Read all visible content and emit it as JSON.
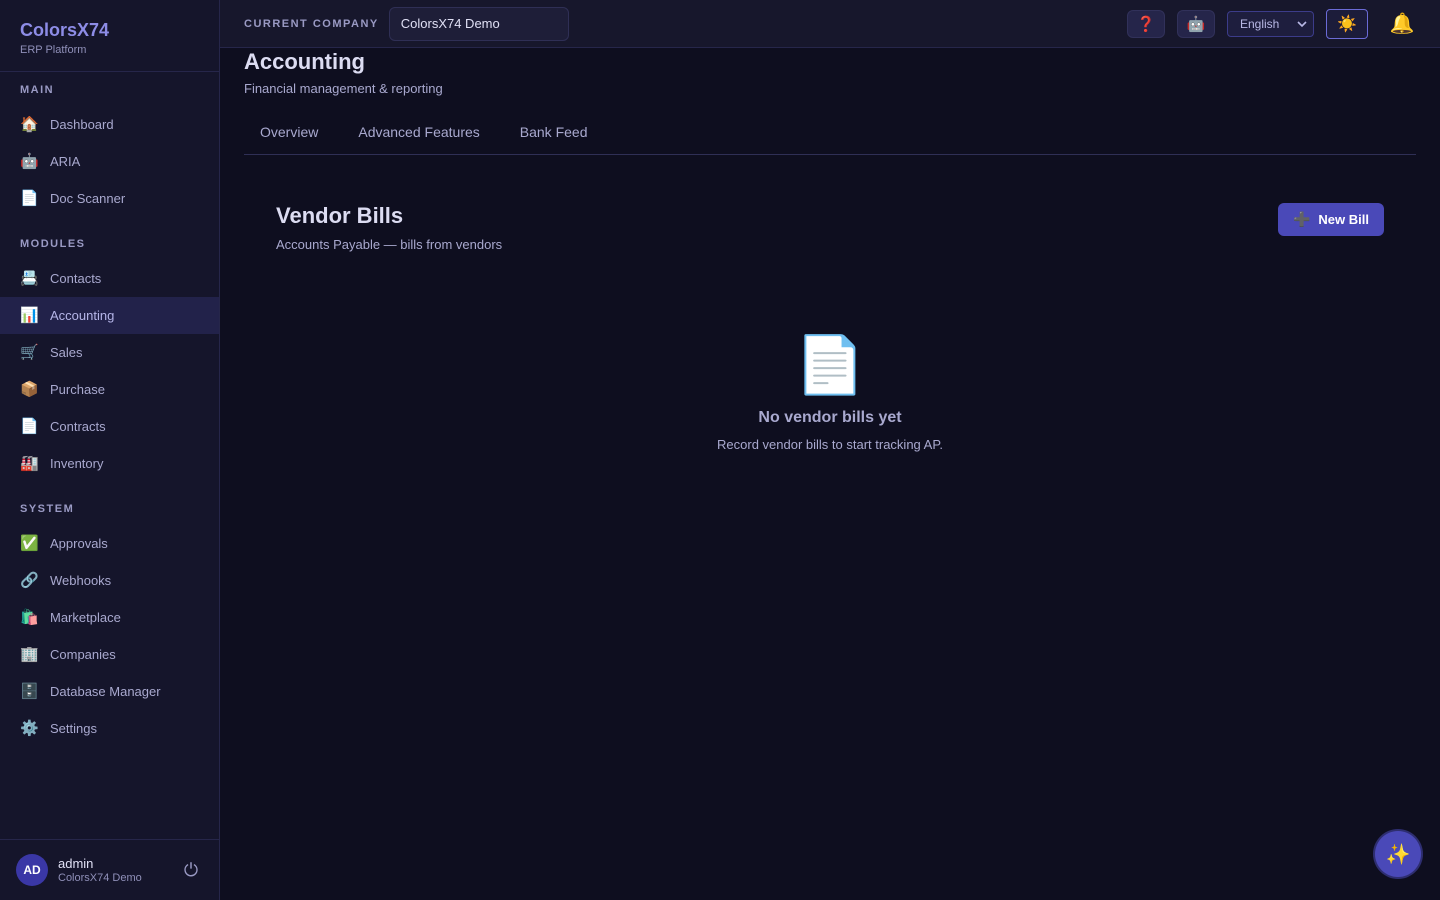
{
  "brand": {
    "name": "ColorsX74",
    "subtitle": "ERP Platform"
  },
  "sidebar": {
    "sections": [
      {
        "label": "MAIN",
        "items": [
          {
            "label": "Dashboard",
            "icon": "🏠"
          },
          {
            "label": "ARIA",
            "icon": "🤖"
          },
          {
            "label": "Doc Scanner",
            "icon": "📄"
          }
        ]
      },
      {
        "label": "MODULES",
        "items": [
          {
            "label": "Contacts",
            "icon": "📇"
          },
          {
            "label": "Accounting",
            "icon": "📊",
            "active": true
          },
          {
            "label": "Sales",
            "icon": "🛒"
          },
          {
            "label": "Purchase",
            "icon": "📦"
          },
          {
            "label": "Contracts",
            "icon": "📄"
          },
          {
            "label": "Inventory",
            "icon": "🏭"
          }
        ]
      },
      {
        "label": "SYSTEM",
        "items": [
          {
            "label": "Approvals",
            "icon": "✅"
          },
          {
            "label": "Webhooks",
            "icon": "🔗"
          },
          {
            "label": "Marketplace",
            "icon": "🛍️"
          },
          {
            "label": "Companies",
            "icon": "🏢"
          },
          {
            "label": "Database Manager",
            "icon": "🗄️"
          },
          {
            "label": "Settings",
            "icon": "⚙️"
          }
        ]
      }
    ]
  },
  "user": {
    "initials": "AD",
    "name": "admin",
    "company": "ColorsX74 Demo",
    "logout_icon": "⏻"
  },
  "topbar": {
    "company_label": "CURRENT COMPANY",
    "company_value": "ColorsX74 Demo",
    "help_icon": "❓",
    "bot_icon": "🤖",
    "language": "English",
    "theme_icon": "☀️",
    "bell_icon": "🔔"
  },
  "page": {
    "title": "Accounting",
    "subtitle": "Financial management & reporting",
    "tabs": [
      "Overview",
      "Advanced Features",
      "Bank Feed"
    ]
  },
  "panel": {
    "title": "Vendor Bills",
    "subtitle": "Accounts Payable — bills from vendors",
    "new_button_icon": "➕",
    "new_button_label": "New Bill"
  },
  "empty_state": {
    "icon": "📄",
    "title": "No vendor bills yet",
    "message": "Record vendor bills to start tracking AP."
  },
  "fab_icon": "✨"
}
